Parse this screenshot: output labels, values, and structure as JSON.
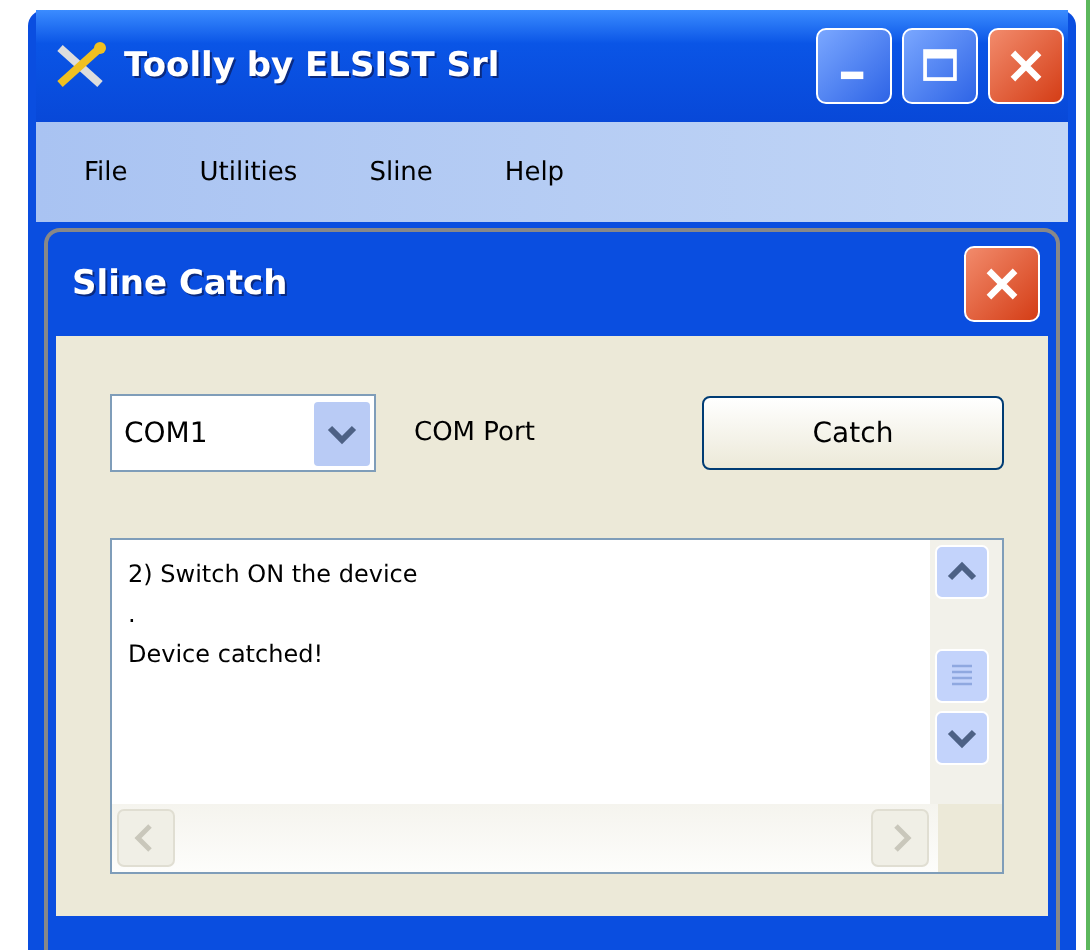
{
  "window": {
    "title": "Toolly by ELSIST Srl"
  },
  "menu": [
    {
      "label": "File"
    },
    {
      "label": "Utilities"
    },
    {
      "label": "Sline"
    },
    {
      "label": "Help"
    }
  ],
  "dialog": {
    "title": "Sline Catch",
    "port": {
      "value": "COM1"
    },
    "port_label": "COM Port",
    "button": "Catch",
    "log": [
      "2) Switch ON the device",
      ".",
      "Device catched!"
    ]
  }
}
